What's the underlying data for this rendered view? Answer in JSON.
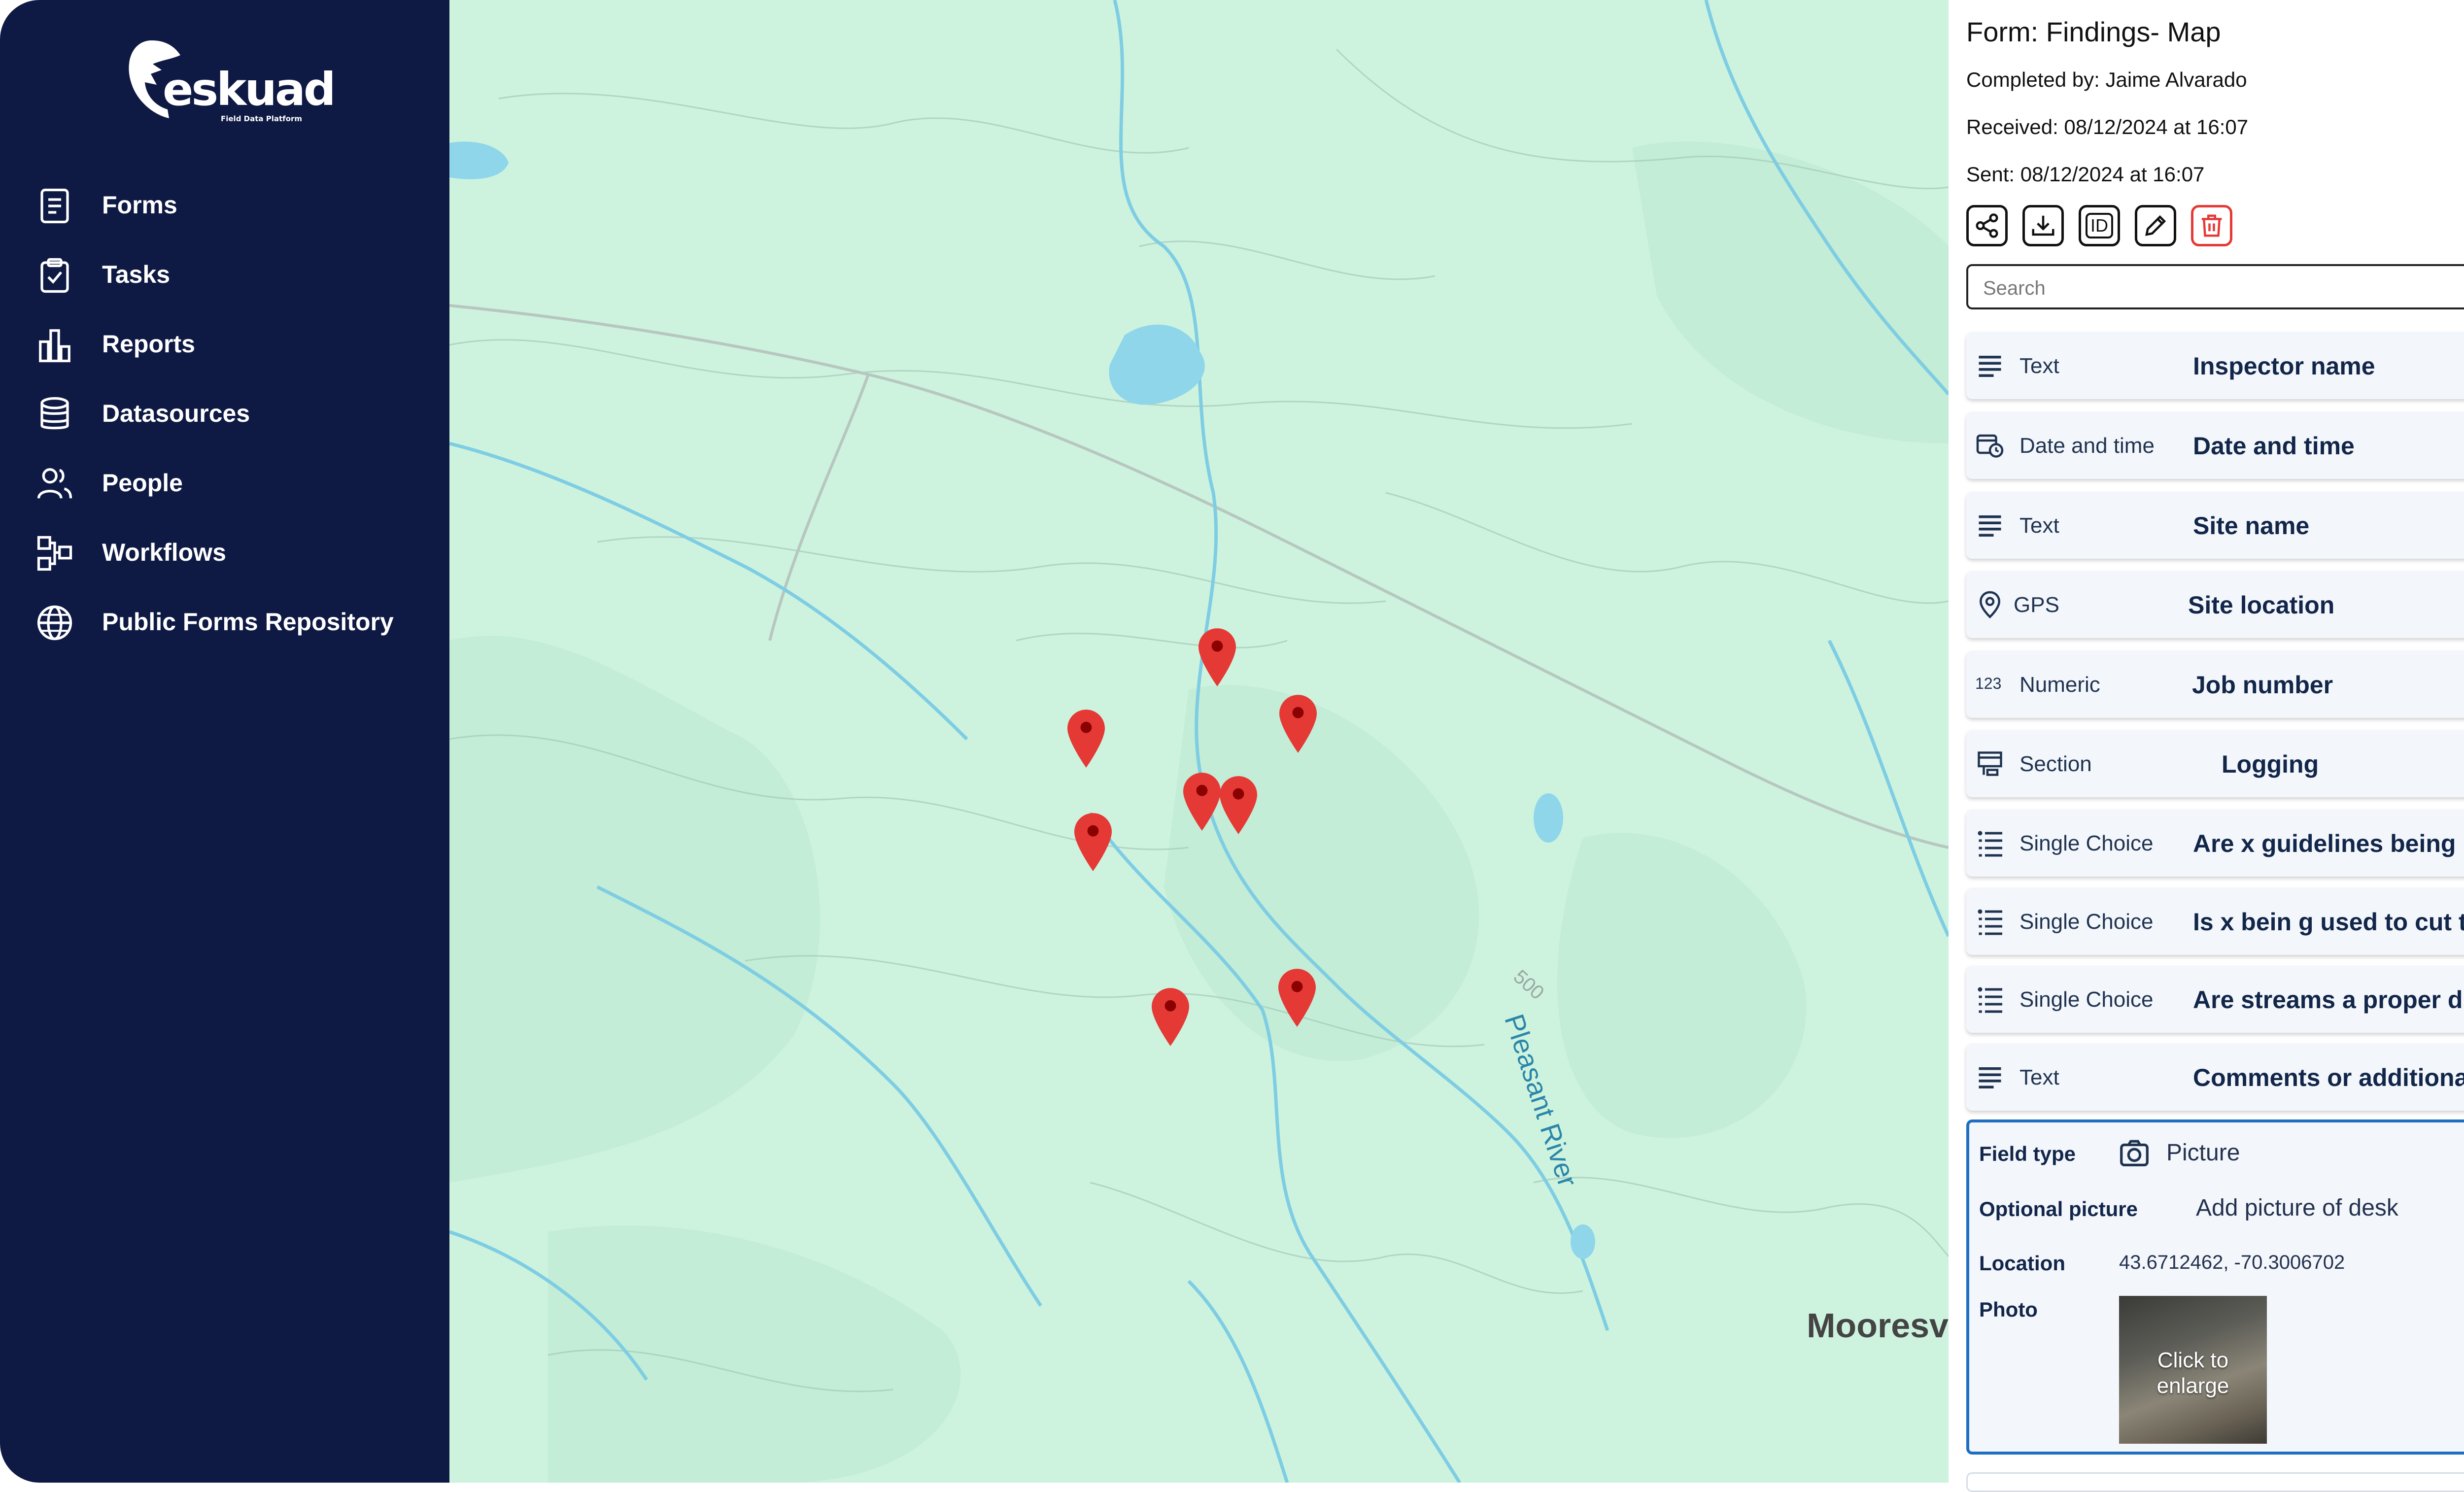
{
  "app": {
    "logo_text": "eskuad",
    "logo_tagline": "Field Data Platform"
  },
  "sidebar": {
    "items": [
      {
        "label": "Forms",
        "icon": "document-icon"
      },
      {
        "label": "Tasks",
        "icon": "clipboard-check-icon"
      },
      {
        "label": "Reports",
        "icon": "bar-chart-icon"
      },
      {
        "label": "Datasources",
        "icon": "database-icon"
      },
      {
        "label": "People",
        "icon": "people-icon"
      },
      {
        "label": "Workflows",
        "icon": "workflow-icon"
      },
      {
        "label": "Public Forms Repository",
        "icon": "globe-icon"
      }
    ]
  },
  "map": {
    "river_label": "Pleasant River",
    "contour_label": "500",
    "town_label": "Mooresv",
    "pins": 8,
    "pin_color": "#e53935"
  },
  "form": {
    "title": "Form: Findings- Map",
    "completed_by": "Completed by: Jaime Alvarado",
    "received": "Received: 08/12/2024  at 16:07",
    "sent": "Sent: 08/12/2024  at 16:07",
    "actions": [
      "share-icon",
      "download-icon",
      "id-icon",
      "edit-icon",
      "trash-icon"
    ],
    "id_label": "ID",
    "search_placeholder": "Search",
    "fields": [
      {
        "type": "Text",
        "name": "Inspector name",
        "icon": "text-lines-icon"
      },
      {
        "type": "Date and time",
        "name": "Date and time",
        "icon": "calendar-clock-icon"
      },
      {
        "type": "Text",
        "name": "Site name",
        "icon": "text-lines-icon"
      },
      {
        "type": "GPS",
        "name": "Site location",
        "icon": "location-pin-icon"
      },
      {
        "type": "Numeric",
        "name": "Job number",
        "icon": "numeric-icon",
        "icon_text": "123"
      },
      {
        "type": "Section",
        "name": "Logging",
        "icon": "section-icon"
      },
      {
        "type": "Single Choice",
        "name": "Are x guidelines being m...",
        "icon": "list-icon"
      },
      {
        "type": "Single Choice",
        "name": "Is x bein g used to cut tre...",
        "icon": "list-icon"
      },
      {
        "type": "Single Choice",
        "name": "Are streams a proper dist...",
        "icon": "list-icon"
      },
      {
        "type": "Text",
        "name": "Comments or additional i...",
        "icon": "text-lines-icon"
      }
    ],
    "detail": {
      "field_type_label": "Field type",
      "field_type_value": "Picture",
      "optional_label": "Optional picture",
      "optional_value": "Add picture of desk",
      "location_label": "Location",
      "location_value": "43.6712462, -70.3006702",
      "photo_label": "Photo",
      "photo_overlay": "Click to enlarge"
    }
  },
  "colors": {
    "sidebar_bg": "#0f1a44",
    "map_bg": "#cdf3df",
    "accent_blue": "#1d6fc1",
    "danger": "#e53935"
  }
}
